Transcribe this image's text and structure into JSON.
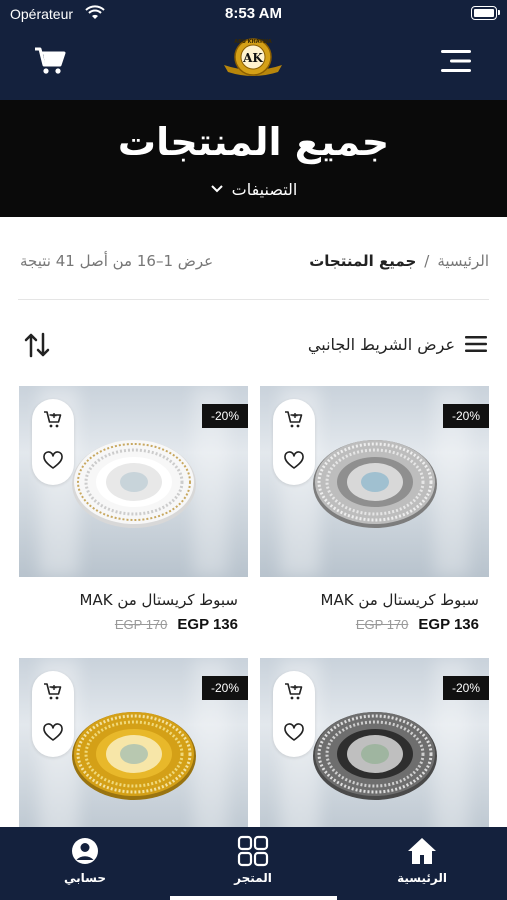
{
  "status_bar": {
    "carrier": "Opérateur",
    "time": "8:53 AM"
  },
  "header": {
    "logo_text": "AK",
    "logo_ring_text": "ABU KHATWA",
    "cart_icon": "cart-icon",
    "menu_icon": "menu-icon"
  },
  "hero": {
    "title": "جميع المنتجات",
    "categories_label": "التصنيفات"
  },
  "breadcrumb": {
    "home": "الرئيسية",
    "separator": "/",
    "current": "جميع المنتجات"
  },
  "results_text": "عرض 1–16 من أصل 41 نتيجة",
  "toolbar": {
    "sidebar_label": "عرض الشريط الجانبي",
    "sort_icon": "sort-icon"
  },
  "products": [
    {
      "name": "سبوط كريستال من MAK",
      "discount": "-20%",
      "old_price": "EGP 170",
      "new_price": "EGP 136",
      "finish": "silver"
    },
    {
      "name": "سبوط كريستال من MAK",
      "discount": "-20%",
      "old_price": "EGP 170",
      "new_price": "EGP 136",
      "finish": "white"
    },
    {
      "name": "",
      "discount": "-20%",
      "old_price": "",
      "new_price": "",
      "finish": "dark"
    },
    {
      "name": "",
      "discount": "-20%",
      "old_price": "",
      "new_price": "",
      "finish": "gold"
    }
  ],
  "bottom_nav": {
    "items": [
      {
        "label": "الرئيسية",
        "icon": "home-icon"
      },
      {
        "label": "المتجر",
        "icon": "grid-icon"
      },
      {
        "label": "حسابي",
        "icon": "user-icon"
      }
    ],
    "active": "المتجر"
  },
  "colors": {
    "navy": "#14213d",
    "hero_bg": "#0a0a0a",
    "badge_bg": "#111111",
    "gold": "#d4a017"
  }
}
